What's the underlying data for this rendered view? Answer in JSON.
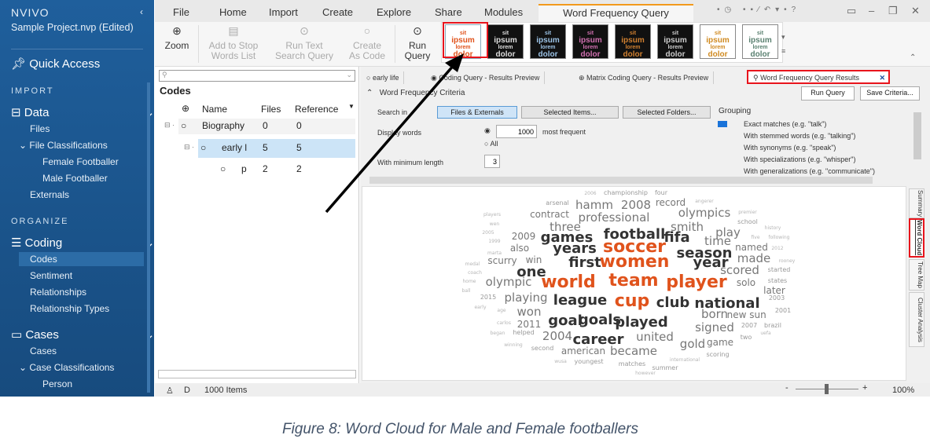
{
  "sidebar": {
    "logo": "NVIVO",
    "project": "Sample Project.nvp (Edited)",
    "quick_access": "Quick Access",
    "import_heading": "IMPORT",
    "data": "Data",
    "files": "Files",
    "file_classifications": "File Classifications",
    "female": "Female Footballer",
    "male": "Male Footballer",
    "externals": "Externals",
    "organize_heading": "ORGANIZE",
    "coding": "Coding",
    "codes": "Codes",
    "sentiment": "Sentiment",
    "relationships": "Relationships",
    "relationship_types": "Relationship Types",
    "cases_group": "Cases",
    "cases": "Cases",
    "case_classifications": "Case Classifications",
    "person": "Person"
  },
  "menu": [
    "File",
    "Home",
    "Import",
    "Create",
    "Explore",
    "Share",
    "Modules",
    "Word Frequency Query"
  ],
  "ribbon": {
    "zoom": "Zoom",
    "add_stop_1": "Add to Stop",
    "add_stop_2": "Words List",
    "run_text_1": "Run Text",
    "run_text_2": "Search Query",
    "create_1": "Create",
    "create_2": "As Code",
    "run_1": "Run",
    "run_2": "Query",
    "thumb_words": [
      "sit",
      "ipsum",
      "lorem",
      "dolor",
      "amet"
    ]
  },
  "codes": {
    "search_placeholder": "",
    "title": "Codes",
    "col_name": "Name",
    "col_files": "Files",
    "col_refs": "Reference",
    "rows": [
      {
        "name": "Biography",
        "files": "0",
        "refs": "0"
      },
      {
        "name": "early l",
        "files": "5",
        "refs": "5"
      },
      {
        "name": "p",
        "files": "2",
        "refs": "2"
      }
    ]
  },
  "tabs": [
    "early life",
    "Coding Query - Results Preview",
    "Matrix Coding Query - Results Preview",
    "Word Frequency Query Results"
  ],
  "criteria": {
    "title": "Word Frequency Criteria",
    "run_query": "Run Query",
    "save": "Save Criteria...",
    "search_in": "Search in",
    "files_externals": "Files & Externals",
    "selected_items": "Selected Items...",
    "selected_folders": "Selected Folders...",
    "display_words": "Display words",
    "count": "1000",
    "most_frequent": "most frequent",
    "all": "All",
    "min_length_label": "With minimum length",
    "min_length": "3",
    "grouping": "Grouping",
    "grouping_options": [
      "Exact matches (e.g. \"talk\")",
      "With stemmed words (e.g. \"talking\")",
      "With synonyms (e.g. \"speak\")",
      "With specializations (e.g. \"whisper\")",
      "With generalizations (e.g. \"communicate\")"
    ],
    "grouping_level": 0
  },
  "view_tabs": [
    "Summary",
    "Word Cloud",
    "Tree Map",
    "Cluster Analysis"
  ],
  "status": {
    "user": "D",
    "items": "1000 Items",
    "zoom": "100%"
  },
  "caption": "Figure 8: Word Cloud for Male and Female footballers",
  "colors": {
    "accent": "#e0531c",
    "highlight": "#e8141c",
    "sidebar": "#1f5f9c"
  },
  "cloud_words": [
    "2006",
    "championship",
    "four",
    "arsenal",
    "hamm",
    "2008",
    "record",
    "angerer",
    "players",
    "contract",
    "professional",
    "olympics",
    "premier",
    "wen",
    "three",
    "smith",
    "school",
    "2005",
    "2009",
    "games",
    "football",
    "fifa",
    "play",
    "history",
    "1999",
    "also",
    "years",
    "soccer",
    "time",
    "five",
    "following",
    "marta",
    "win",
    "season",
    "named",
    "2012",
    "medal",
    "scurry",
    "first",
    "women",
    "year",
    "made",
    "rooney",
    "coach",
    "one",
    "scored",
    "started",
    "home",
    "olympic",
    "world",
    "team",
    "player",
    "solo",
    "states",
    "ball",
    "later",
    "2015",
    "playing",
    "league",
    "cup",
    "club",
    "national",
    "2003",
    "early",
    "age",
    "won",
    "born",
    "new",
    "sun",
    "2001",
    "carlos",
    "2011",
    "goal",
    "goals",
    "played",
    "signed",
    "2007",
    "brazil",
    "began",
    "helped",
    "2004",
    "career",
    "united",
    "two",
    "uefa",
    "gold",
    "game",
    "winning",
    "second",
    "american",
    "became",
    "scoring",
    "international",
    "wusa",
    "youngest",
    "matches",
    "summer",
    "however"
  ]
}
